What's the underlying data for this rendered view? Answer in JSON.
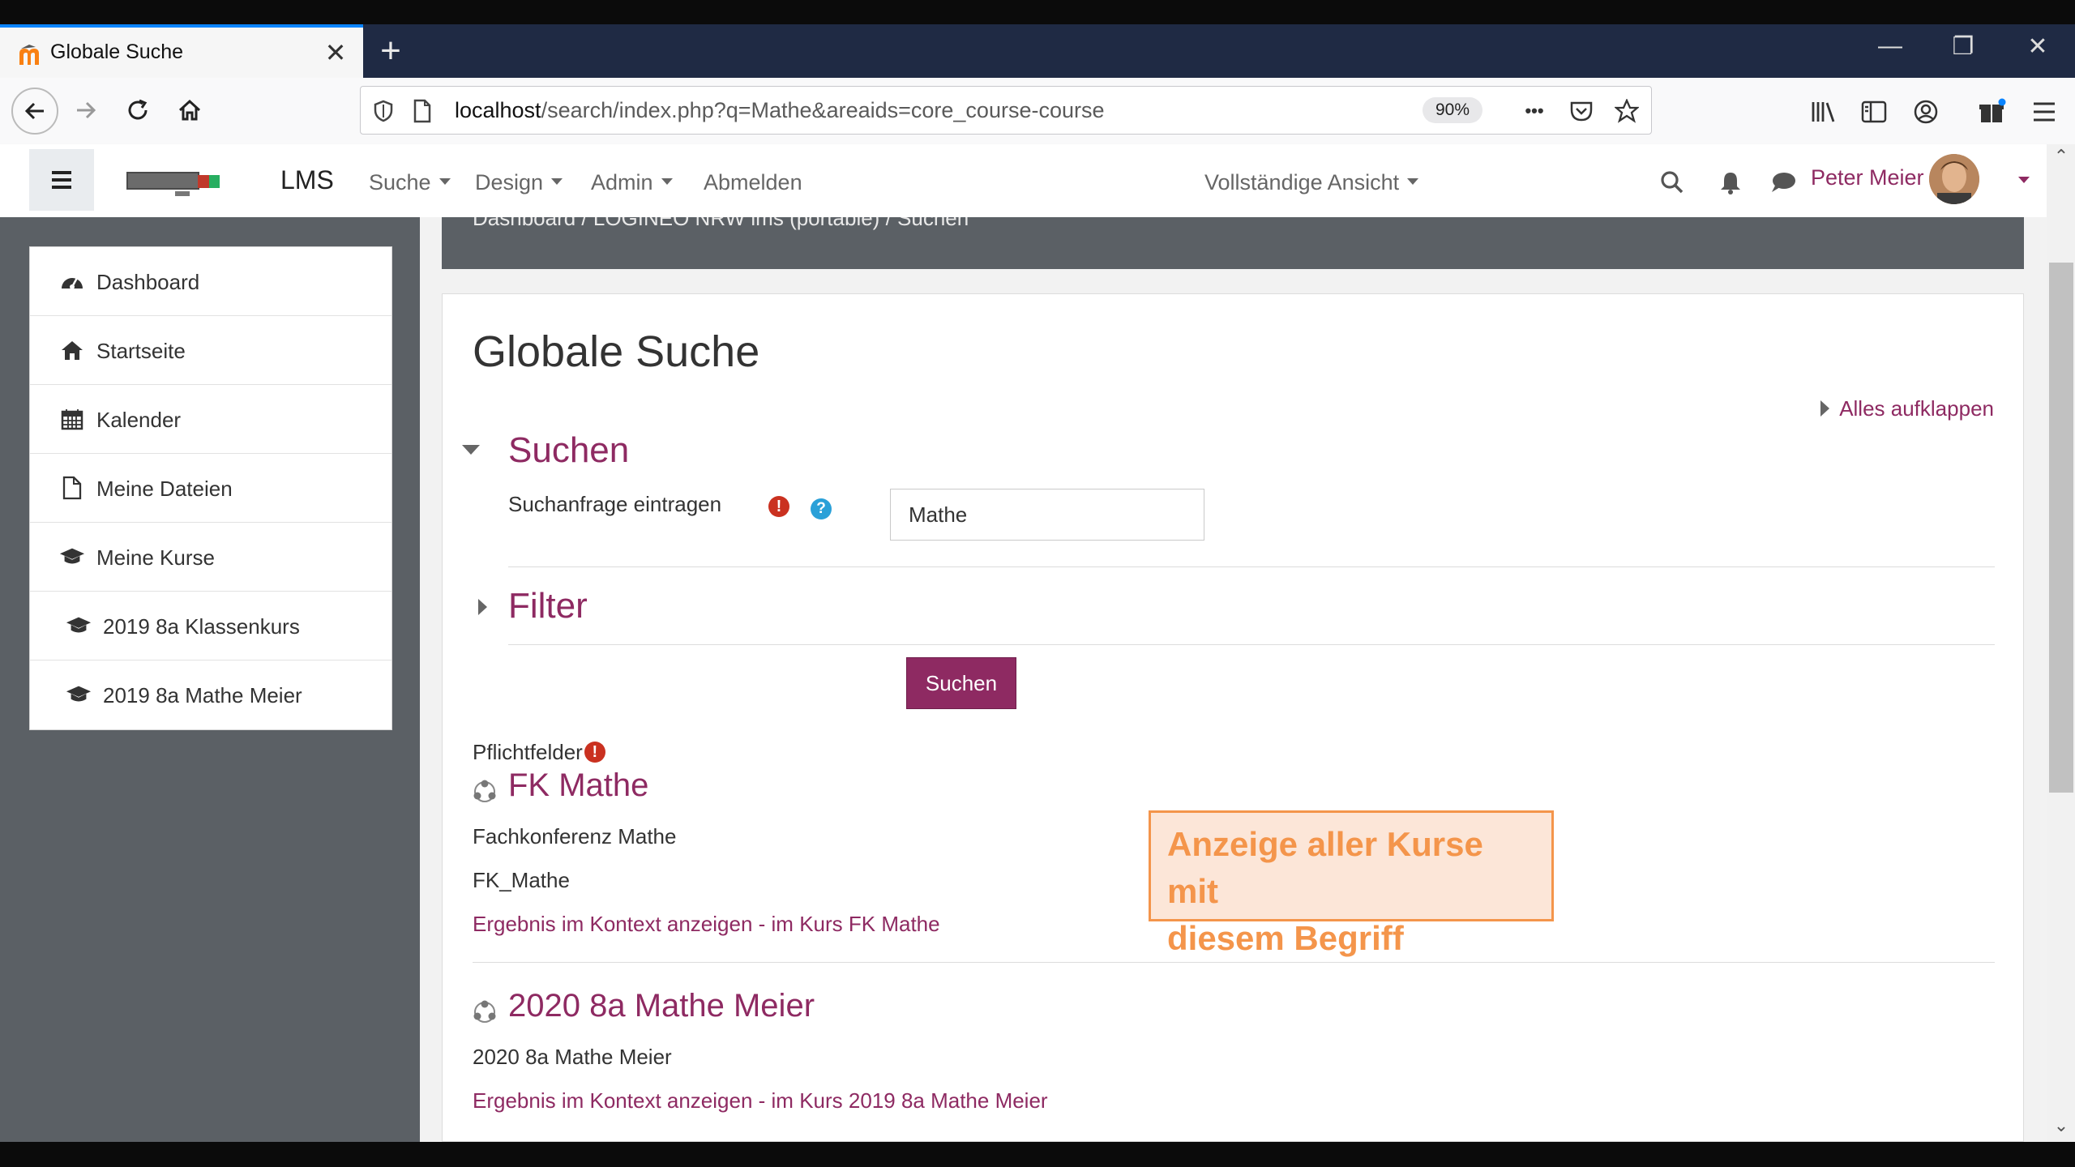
{
  "browser": {
    "tab_title": "Globale Suche",
    "tab_close": "✕",
    "new_tab": "+",
    "url_host": "localhost",
    "url_path": "/search/index.php?q=Mathe&areaids=core_course-course",
    "zoom": "90%",
    "more": "•••"
  },
  "header": {
    "brand": "LMS",
    "menu": {
      "suche": "Suche",
      "design": "Design",
      "admin": "Admin",
      "abmelden": "Abmelden"
    },
    "view_mode": "Vollständige Ansicht",
    "user_name": "Peter Meier"
  },
  "sidebar": {
    "items": [
      {
        "label": "Dashboard",
        "icon": "dashboard-icon"
      },
      {
        "label": "Startseite",
        "icon": "home-icon"
      },
      {
        "label": "Kalender",
        "icon": "calendar-icon"
      },
      {
        "label": "Meine Dateien",
        "icon": "file-icon"
      },
      {
        "label": "Meine Kurse",
        "icon": "graduation-cap-icon"
      },
      {
        "label": "2019 8a Klassenkurs",
        "icon": "graduation-cap-icon"
      },
      {
        "label": "2019 8a Mathe Meier",
        "icon": "graduation-cap-icon"
      }
    ]
  },
  "breadcrumb": {
    "text": "Dashboard  /  LOGINEO NRW lms (portable)  /  Suchen"
  },
  "main": {
    "title": "Globale Suche",
    "expand_all": "Alles aufklappen",
    "section_search": "Suchen",
    "query_label": "Suchanfrage eintragen",
    "query_value": "Mathe",
    "section_filter": "Filter",
    "submit_label": "Suchen",
    "required_note": "Pflichtfelder"
  },
  "results": [
    {
      "title": "FK Mathe",
      "lines": [
        "Fachkonferenz Mathe",
        "FK_Mathe"
      ],
      "link": "Ergebnis im Kontext anzeigen - im Kurs FK Mathe"
    },
    {
      "title": "2020 8a Mathe Meier",
      "lines": [
        "2020 8a Mathe Meier"
      ],
      "link": "Ergebnis im Kontext anzeigen - im Kurs 2019 8a Mathe Meier"
    }
  ],
  "annotation": {
    "line1": "Anzeige aller Kurse mit",
    "line2": "diesem Begriff"
  },
  "colors": {
    "accent": "#8e2a62",
    "drawer": "#5b6065",
    "annotation": "#f4954b",
    "required": "#ca3120"
  }
}
